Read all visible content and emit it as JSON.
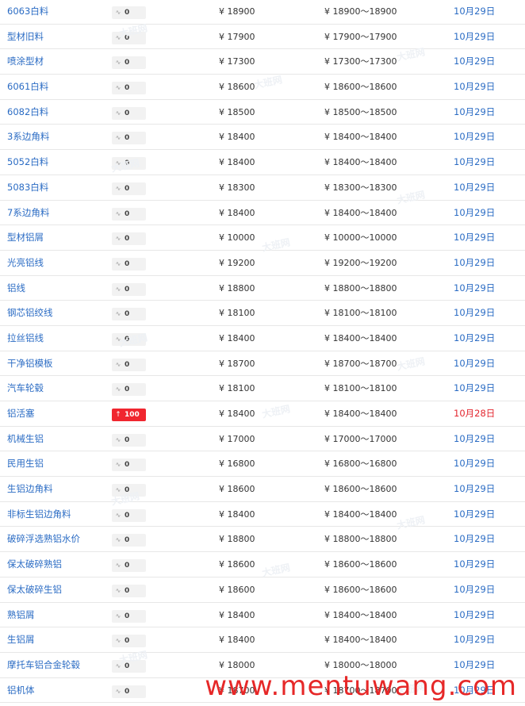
{
  "currency_symbol": "¥",
  "rows": [
    {
      "name": "6063白料",
      "change": "0",
      "direction": "flat",
      "price": "18900",
      "range": "18900～18900",
      "date": "10月29日"
    },
    {
      "name": "型材旧料",
      "change": "0",
      "direction": "flat",
      "price": "17900",
      "range": "17900～17900",
      "date": "10月29日"
    },
    {
      "name": "喷涂型材",
      "change": "0",
      "direction": "flat",
      "price": "17300",
      "range": "17300～17300",
      "date": "10月29日"
    },
    {
      "name": "6061白料",
      "change": "0",
      "direction": "flat",
      "price": "18600",
      "range": "18600～18600",
      "date": "10月29日"
    },
    {
      "name": "6082白料",
      "change": "0",
      "direction": "flat",
      "price": "18500",
      "range": "18500～18500",
      "date": "10月29日"
    },
    {
      "name": "3系边角料",
      "change": "0",
      "direction": "flat",
      "price": "18400",
      "range": "18400～18400",
      "date": "10月29日"
    },
    {
      "name": "5052白料",
      "change": "0",
      "direction": "flat",
      "price": "18400",
      "range": "18400～18400",
      "date": "10月29日"
    },
    {
      "name": "5083白料",
      "change": "0",
      "direction": "flat",
      "price": "18300",
      "range": "18300～18300",
      "date": "10月29日"
    },
    {
      "name": "7系边角料",
      "change": "0",
      "direction": "flat",
      "price": "18400",
      "range": "18400～18400",
      "date": "10月29日"
    },
    {
      "name": "型材铝屑",
      "change": "0",
      "direction": "flat",
      "price": "10000",
      "range": "10000～10000",
      "date": "10月29日"
    },
    {
      "name": "光亮铝线",
      "change": "0",
      "direction": "flat",
      "price": "19200",
      "range": "19200～19200",
      "date": "10月29日"
    },
    {
      "name": "铝线",
      "change": "0",
      "direction": "flat",
      "price": "18800",
      "range": "18800～18800",
      "date": "10月29日"
    },
    {
      "name": "钢芯铝绞线",
      "change": "0",
      "direction": "flat",
      "price": "18100",
      "range": "18100～18100",
      "date": "10月29日"
    },
    {
      "name": "拉丝铝线",
      "change": "0",
      "direction": "flat",
      "price": "18400",
      "range": "18400～18400",
      "date": "10月29日"
    },
    {
      "name": "干净铝模板",
      "change": "0",
      "direction": "flat",
      "price": "18700",
      "range": "18700～18700",
      "date": "10月29日"
    },
    {
      "name": "汽车轮毂",
      "change": "0",
      "direction": "flat",
      "price": "18100",
      "range": "18100～18100",
      "date": "10月29日"
    },
    {
      "name": "铝活塞",
      "change": "100",
      "direction": "up",
      "price": "18400",
      "range": "18400～18400",
      "date": "10月28日"
    },
    {
      "name": "机械生铝",
      "change": "0",
      "direction": "flat",
      "price": "17000",
      "range": "17000～17000",
      "date": "10月29日"
    },
    {
      "name": "民用生铝",
      "change": "0",
      "direction": "flat",
      "price": "16800",
      "range": "16800～16800",
      "date": "10月29日"
    },
    {
      "name": "生铝边角料",
      "change": "0",
      "direction": "flat",
      "price": "18600",
      "range": "18600～18600",
      "date": "10月29日"
    },
    {
      "name": "非标生铝边角料",
      "change": "0",
      "direction": "flat",
      "price": "18400",
      "range": "18400～18400",
      "date": "10月29日"
    },
    {
      "name": "破碎浮选熟铝水价",
      "change": "0",
      "direction": "flat",
      "price": "18800",
      "range": "18800～18800",
      "date": "10月29日"
    },
    {
      "name": "保太破碎熟铝",
      "change": "0",
      "direction": "flat",
      "price": "18600",
      "range": "18600～18600",
      "date": "10月29日"
    },
    {
      "name": "保太破碎生铝",
      "change": "0",
      "direction": "flat",
      "price": "18600",
      "range": "18600～18600",
      "date": "10月29日"
    },
    {
      "name": "熟铝屑",
      "change": "0",
      "direction": "flat",
      "price": "18400",
      "range": "18400～18400",
      "date": "10月29日"
    },
    {
      "name": "生铝屑",
      "change": "0",
      "direction": "flat",
      "price": "18400",
      "range": "18400～18400",
      "date": "10月29日"
    },
    {
      "name": "摩托车铝合金轮毂",
      "change": "0",
      "direction": "flat",
      "price": "18000",
      "range": "18000～18000",
      "date": "10月29日"
    },
    {
      "name": "铝机体",
      "change": "0",
      "direction": "flat",
      "price": "18700",
      "range": "18700～18700",
      "date": "10月29日"
    }
  ],
  "watermark_text": "大班网",
  "site_watermark": "www.mentuwang.com",
  "colors": {
    "link": "#2b6cc4",
    "up_badge": "#f0262f",
    "date_changed": "#e3262f",
    "flat_badge": "#f2f2f2",
    "site_watermark": "#e62828"
  },
  "icons": {
    "flat": "flat-wave-icon",
    "up": "arrow-up-icon"
  }
}
